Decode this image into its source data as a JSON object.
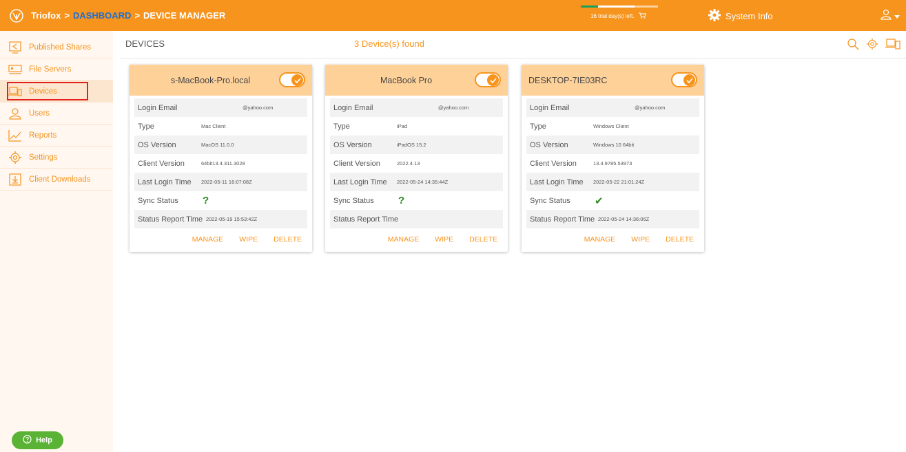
{
  "header": {
    "brand": "Triofox",
    "sep1": ">",
    "crumb_dashboard": "DASHBOARD",
    "sep2": ">",
    "crumb_page": "DEVICE MANAGER",
    "trial_text": "16 trial day(s) left.",
    "trial_progress": 0.7,
    "system_info": "System Info",
    "brand_color": "#f7941d",
    "link_color": "#1f6fcf"
  },
  "sidebar": {
    "items": [
      {
        "label": "Published Shares",
        "icon": "published-shares-icon"
      },
      {
        "label": "File Servers",
        "icon": "file-servers-icon"
      },
      {
        "label": "Devices",
        "icon": "devices-icon",
        "active": true
      },
      {
        "label": "Users",
        "icon": "users-icon"
      },
      {
        "label": "Reports",
        "icon": "reports-icon"
      },
      {
        "label": "Settings",
        "icon": "settings-icon"
      },
      {
        "label": "Client Downloads",
        "icon": "client-downloads-icon"
      }
    ],
    "help_label": "Help"
  },
  "main": {
    "title": "DEVICES",
    "found": "3 Device(s) found"
  },
  "labels": {
    "login_email": "Login Email",
    "type": "Type",
    "os_version": "OS Version",
    "client_version": "Client Version",
    "last_login": "Last Login Time",
    "sync_status": "Sync Status",
    "status_report": "Status Report Time",
    "manage": "MANAGE",
    "wipe": "WIPE",
    "delete": "DELETE"
  },
  "devices": [
    {
      "name": "s-MacBook-Pro.local",
      "enabled": true,
      "email": "@yahoo.com",
      "type": "Mac Client",
      "os_version": "MacOS 11.0.0",
      "client_version": "64bit13.4.311.3028",
      "last_login": "2022-05-11 16:07:08Z",
      "sync_status": "?",
      "sync_state": "unknown",
      "status_report": "2022-05-19 15:53:42Z"
    },
    {
      "name": "MacBook Pro",
      "enabled": true,
      "email": "@yahoo.com",
      "type": "iPad",
      "os_version": "iPadOS 15.2",
      "client_version": "2022.4.13",
      "last_login": "2022-05-24 14:35:44Z",
      "sync_status": "?",
      "sync_state": "unknown",
      "status_report": ""
    },
    {
      "name": "DESKTOP-7IE03RC",
      "enabled": true,
      "email": "@yahoo.com",
      "type": "Windows Client",
      "os_version": "Windows 10 64bit",
      "client_version": "13.4.9785.53973",
      "last_login": "2022-05-22 21:01:24Z",
      "sync_status": "✔",
      "sync_state": "ok",
      "status_report": "2022-05-24 14:36:06Z"
    }
  ]
}
